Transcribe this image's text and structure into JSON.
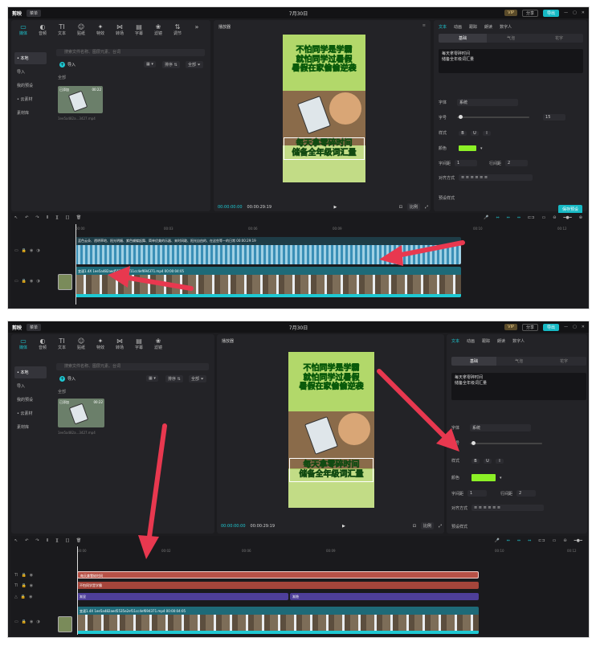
{
  "app": {
    "logo": "剪映",
    "menu_label": "菜单",
    "date_title": "7月30日",
    "vip_label": "VIP",
    "share_label": "分享",
    "export_label": "导出",
    "win_min": "—",
    "win_max": "▢",
    "win_close": "✕"
  },
  "asset_tabs": [
    {
      "label": "媒体",
      "icon": "▭"
    },
    {
      "label": "音频",
      "icon": "◐"
    },
    {
      "label": "文本",
      "icon": "TI"
    },
    {
      "label": "贴纸",
      "icon": "☺"
    },
    {
      "label": "特效",
      "icon": "✦"
    },
    {
      "label": "转场",
      "icon": "⋈"
    },
    {
      "label": "字幕",
      "icon": "▤"
    },
    {
      "label": "滤镜",
      "icon": "❀"
    },
    {
      "label": "调节",
      "icon": "⇅"
    }
  ],
  "asset_tabs_more": "»",
  "sidebar": [
    {
      "label": "• 本地"
    },
    {
      "label": "导入"
    },
    {
      "label": "我的预设"
    },
    {
      "label": "• 云素材"
    },
    {
      "label": "素材库"
    }
  ],
  "media": {
    "search_placeholder": "搜索文件名称、图层元素、台词",
    "import_label": "导入",
    "sort_label": "排序",
    "all_filter": "全部",
    "all_label": "全部",
    "clip_tag": "已添加",
    "clip_duration": "00:22",
    "clip_filename": "1ee5a482a...3427.mp4"
  },
  "player": {
    "title": "播放器",
    "caption_top": [
      "不怕同学是学霸",
      "就怕同学过暑假",
      "暑假在家偷偷逆袭"
    ],
    "caption_bottom": [
      "每天拿零碎时间",
      "储备全年级词汇量"
    ],
    "time_current": "00:00:00:00",
    "time_total": "00:00:29:19",
    "play_icon": "▶",
    "ratio_label": "比例",
    "fit_icon": "⊡",
    "fullscreen_icon": "⤢"
  },
  "inspector": {
    "tabs_1": [
      "文本",
      "动画",
      "跟踪",
      "朗读",
      "数字人"
    ],
    "tabs_2": [
      "文本",
      "动画",
      "跟踪",
      "朗读",
      "数字人"
    ],
    "segments": [
      "基础",
      "气泡",
      "花字"
    ],
    "text_box": [
      "每天拿零碎时间",
      "储备全年级词汇量"
    ],
    "font_label": "字体",
    "font_value": "系统",
    "size_label": "字号",
    "size_value": "15",
    "style_label": "样式",
    "style_bold": "B",
    "style_underline": "U",
    "style_italic": "I",
    "color_label": "颜色",
    "color_value": "#8cf026",
    "char_spacing_label": "字间距",
    "char_spacing_value": "1",
    "line_spacing_label": "行间距",
    "line_spacing_value": "2",
    "align_label": "对齐方式",
    "preset_label": "预设样式",
    "save_preset": "保存预设"
  },
  "timeline": {
    "ruler_1": [
      "00:00",
      "00:03",
      "00:06",
      "00:09",
      "00:10",
      "00:12"
    ],
    "ruler_2": [
      "00:00",
      "00:02",
      "00:06",
      "00:09",
      "00:10",
      "00:12"
    ],
    "cover_label": "封面",
    "caption_track_text": "蓝色云朵、透明草地、阳光明媚、紫色蝴蝶起舞、简单优美的乐器、来时间敢、阳光自由的、在这些等一的日常   00:00:29:19",
    "video_clip_label": "变速1.4X  1ee5a482aed5535e2ef11cc4ef694371.mp4  00:00:04:05",
    "video_clip_label_short": "变速1.4X  1ee5a482aed5535e2ef11cc4ef694371.mp4",
    "text_tracks": [
      "每天拿零碎时间",
      "不怕同学是学霸"
    ],
    "purple_tracks": [
      "渐显",
      "渐隐"
    ]
  },
  "colors": {
    "accent": "#1ec8d2",
    "arrow": "#e8384f",
    "text_green": "#8cf026"
  }
}
